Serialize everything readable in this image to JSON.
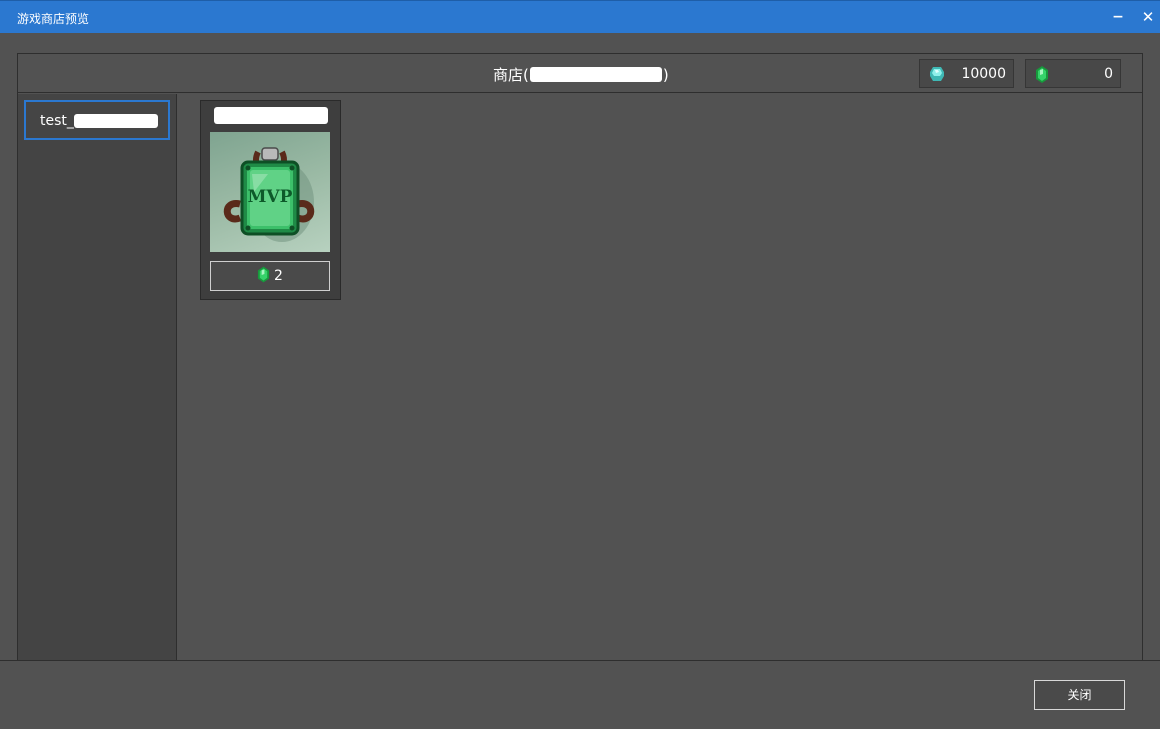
{
  "window": {
    "title": "游戏商店预览",
    "minimize_label": "−",
    "close_label": "✕"
  },
  "shop": {
    "title_prefix": "商店(",
    "title_suffix": ")"
  },
  "currencies": [
    {
      "icon": "diamond-icon",
      "value": "10000",
      "color": "#5fd3d0"
    },
    {
      "icon": "emerald-icon",
      "value": "0",
      "color": "#2fc45a"
    }
  ],
  "categories": [
    {
      "label": "test_",
      "selected": true
    }
  ],
  "items": [
    {
      "icon": "mvp-badge-icon",
      "price_icon": "emerald-icon",
      "price": "2"
    }
  ],
  "footer": {
    "close_label": "关闭"
  },
  "colors": {
    "titlebar": "#2b78d0",
    "background": "#525252",
    "selection": "#2b78d0"
  }
}
